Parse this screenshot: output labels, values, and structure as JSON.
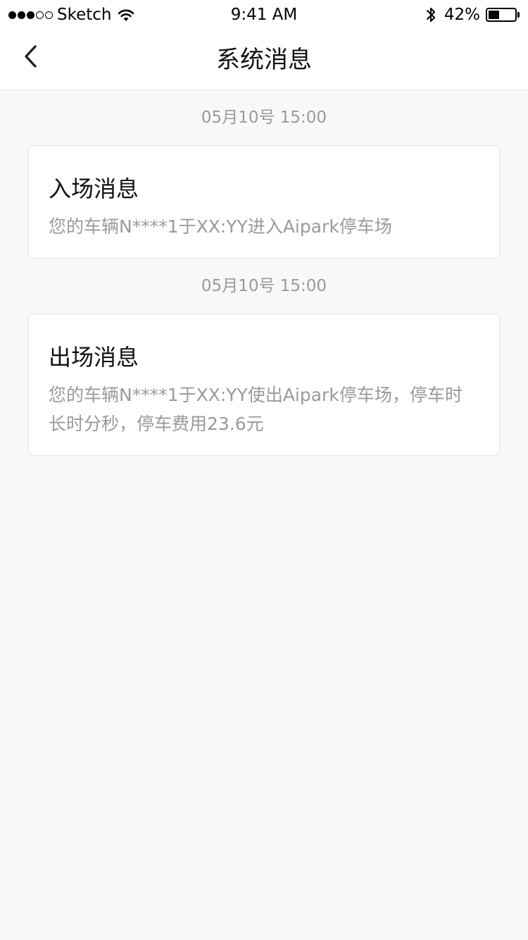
{
  "status_bar": {
    "carrier": "Sketch",
    "time": "9:41 AM",
    "battery_percent": "42%",
    "battery_level": 0.42
  },
  "nav": {
    "title": "系统消息",
    "back_icon": "chevron-left-icon"
  },
  "messages": [
    {
      "timestamp": "05月10号 15:00",
      "title": "入场消息",
      "body": "您的车辆N****1于XX:YY进入Aipark停车场"
    },
    {
      "timestamp": "05月10号 15:00",
      "title": "出场消息",
      "body": "您的车辆N****1于XX:YY使出Aipark停车场，停车时长时分秒，停车费用23.6元"
    }
  ],
  "colors": {
    "background": "#f7f8fa",
    "card": "#ffffff",
    "secondary_text": "#9a9a9a",
    "primary_text": "#111111"
  }
}
